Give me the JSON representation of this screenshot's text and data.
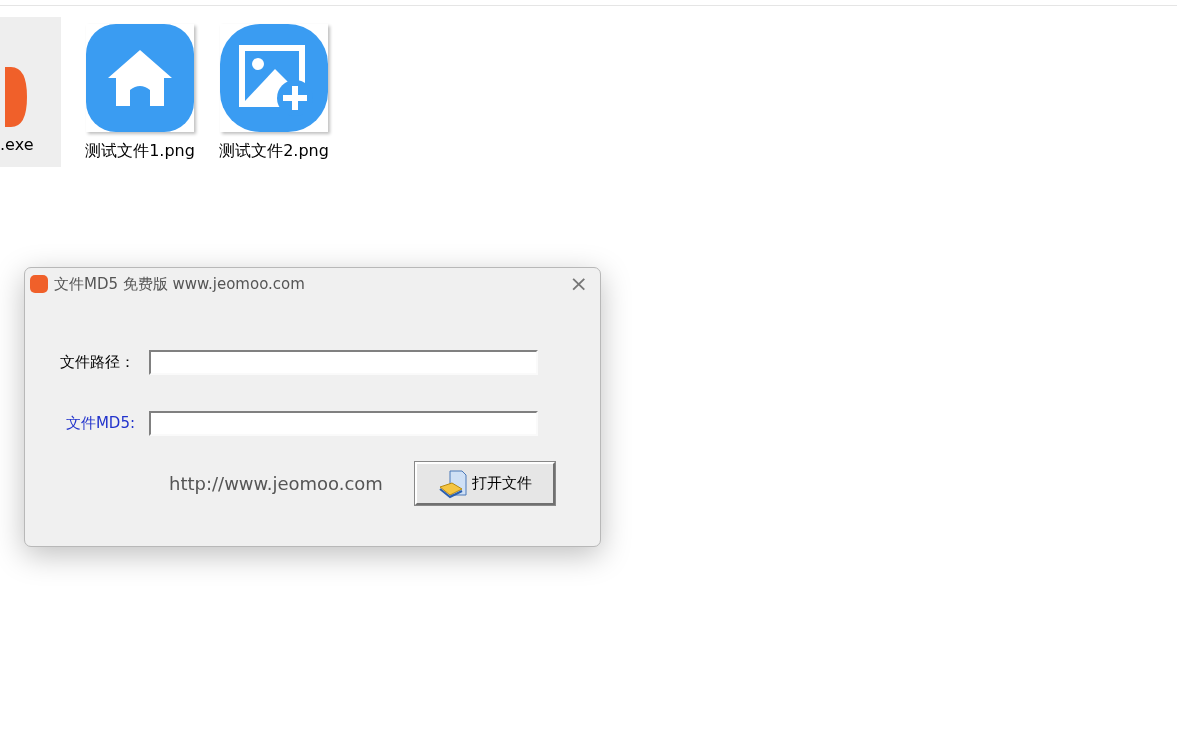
{
  "files": [
    {
      "kind": "exe",
      "label": ".exe",
      "selected": true
    },
    {
      "kind": "home",
      "label": "测试文件1.png",
      "selected": false
    },
    {
      "kind": "image-add",
      "label": "测试文件2.png",
      "selected": false
    }
  ],
  "dialog": {
    "title": "文件MD5 免费版 www.jeomoo.com",
    "close": "×",
    "fields": [
      {
        "label": "文件路径：",
        "highlight": false
      },
      {
        "label": "文件MD5:",
        "highlight": true
      }
    ],
    "link": "http://www.jeomoo.com",
    "button": "打开文件"
  }
}
